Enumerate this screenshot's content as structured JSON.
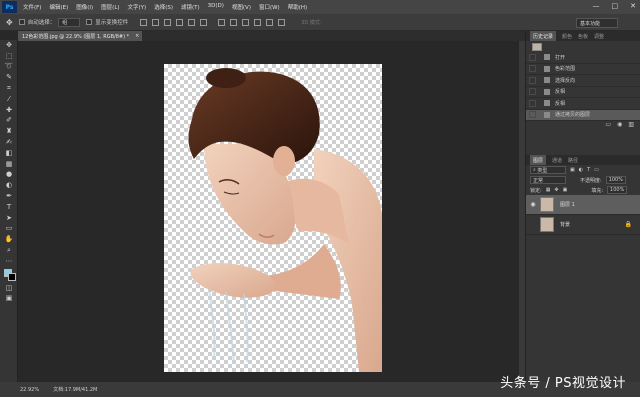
{
  "app": {
    "logo": "Ps"
  },
  "menu": [
    "文件(F)",
    "编辑(E)",
    "图像(I)",
    "图层(L)",
    "文字(Y)",
    "选择(S)",
    "滤镜(T)",
    "3D(D)",
    "视图(V)",
    "窗口(W)",
    "帮助(H)"
  ],
  "window_controls": {
    "minimize": "—",
    "maximize": "□",
    "close": "✕"
  },
  "options": {
    "auto_select_label": "自动选择：",
    "auto_select_target": "组",
    "show_transform_label": "显示变换控件",
    "mode_3d": "3D 模式：",
    "workspace": "基本功能"
  },
  "document": {
    "tab_title": "12色彩范围.jpg @ 22.9% (图层 1, RGB/8#) *",
    "close_glyph": "×",
    "zoom": "22.92%",
    "doc_info": "文档:17.9M/41.2M"
  },
  "history_panel": {
    "tabs": [
      "历史记录",
      "颜色",
      "色板",
      "调整"
    ],
    "items": [
      {
        "label": "打开"
      },
      {
        "label": "色彩范围"
      },
      {
        "label": "选择反向"
      },
      {
        "label": "反相"
      },
      {
        "label": "反相"
      },
      {
        "label": "通过拷贝的图层"
      }
    ],
    "selected_index": 5
  },
  "layers_panel": {
    "tabs": [
      "图层",
      "通道",
      "路径"
    ],
    "filter_label": "类型",
    "blend_mode": "正常",
    "opacity_label": "不透明度:",
    "opacity_value": "100%",
    "lock_label": "锁定:",
    "fill_label": "填充:",
    "fill_value": "100%",
    "layers": [
      {
        "name": "图层 1",
        "visible": true,
        "locked": false
      },
      {
        "name": "背景",
        "visible": false,
        "locked": true
      }
    ]
  },
  "watermark": "头条号 / PS视觉设计",
  "colors": {
    "foreground": "#87ceeb",
    "background": "#000000",
    "accent": "#31a8ff"
  }
}
